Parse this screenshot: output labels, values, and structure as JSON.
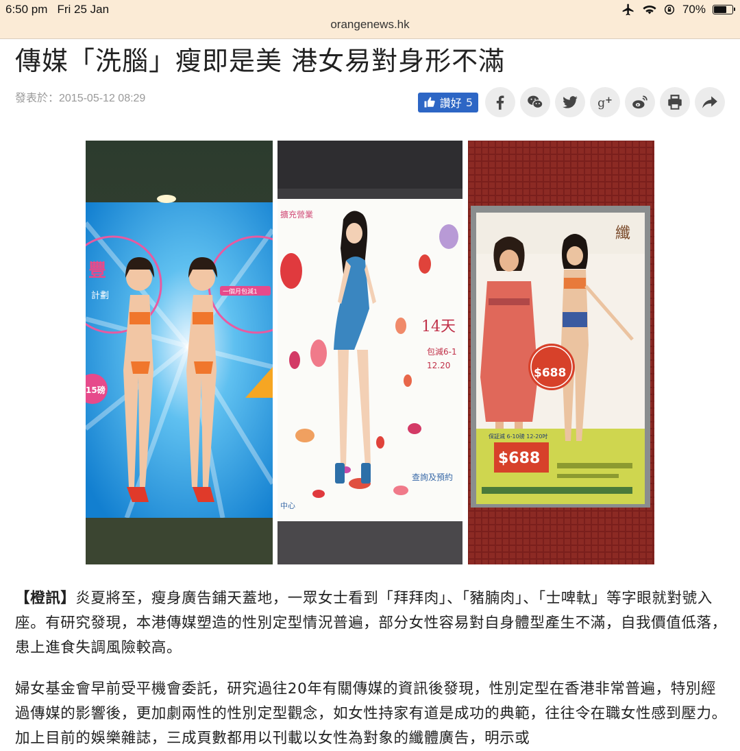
{
  "status_bar": {
    "time": "6:50 pm",
    "date": "Fri 25 Jan",
    "battery_text": "70%",
    "battery_level": 0.7
  },
  "address_bar": {
    "url": "orangenews.hk"
  },
  "article": {
    "headline": "傳媒「洗腦」瘦即是美 港女易對身形不滿",
    "published": "發表於：2015-05-12 08:29",
    "like_label": "讚好",
    "like_count": "5",
    "paragraph1_lead": "【橙訊】",
    "paragraph1": "炎夏將至，瘦身廣告鋪天蓋地，一眾女士看到「拜拜肉」、「豬腩肉」、「士啤軚」等字眼就對號入座。有研究發現，本港傳媒塑造的性別定型情況普遍，部分女性容易對自身體型產生不滿，自我價值低落，患上進食失調風險較高。",
    "paragraph2": "婦女基金會早前受平機會委託，研究過往20年有關傳媒的資訊後發現，性別定型在香港非常普遍，特別經過傳媒的影響後，更加劇兩性的性別定型觀念，如女性持家有道是成功的典範，往往令在職女性感到壓力。加上目前的娛樂雜誌，三成頁數都用以刊載以女性為對象的纖體廣告，明示或"
  },
  "share_buttons": [
    {
      "name": "facebook-icon"
    },
    {
      "name": "wechat-icon"
    },
    {
      "name": "twitter-icon"
    },
    {
      "name": "google-plus-icon"
    },
    {
      "name": "weibo-icon"
    },
    {
      "name": "print-icon"
    },
    {
      "name": "share-icon"
    }
  ],
  "photo_text": {
    "poster1_a": "豐",
    "poster1_b": "計劃",
    "poster1_c": "一個月包減1",
    "poster1_d": "15磅",
    "poster2_a": "擴充營業",
    "poster2_b": "14天",
    "poster2_c": "包減6-1",
    "poster2_d": "12.20",
    "poster2_e": "查詢及預約",
    "poster2_f": "中心",
    "poster3_a": "纖",
    "poster3_b": "$688",
    "poster3_c": "$688",
    "poster3_d": "保証減 6-10磅 12-20吋"
  },
  "colors": {
    "topbar_bg": "#fbebd6",
    "like_blue": "#2d66c5",
    "share_bg": "#ececec"
  }
}
